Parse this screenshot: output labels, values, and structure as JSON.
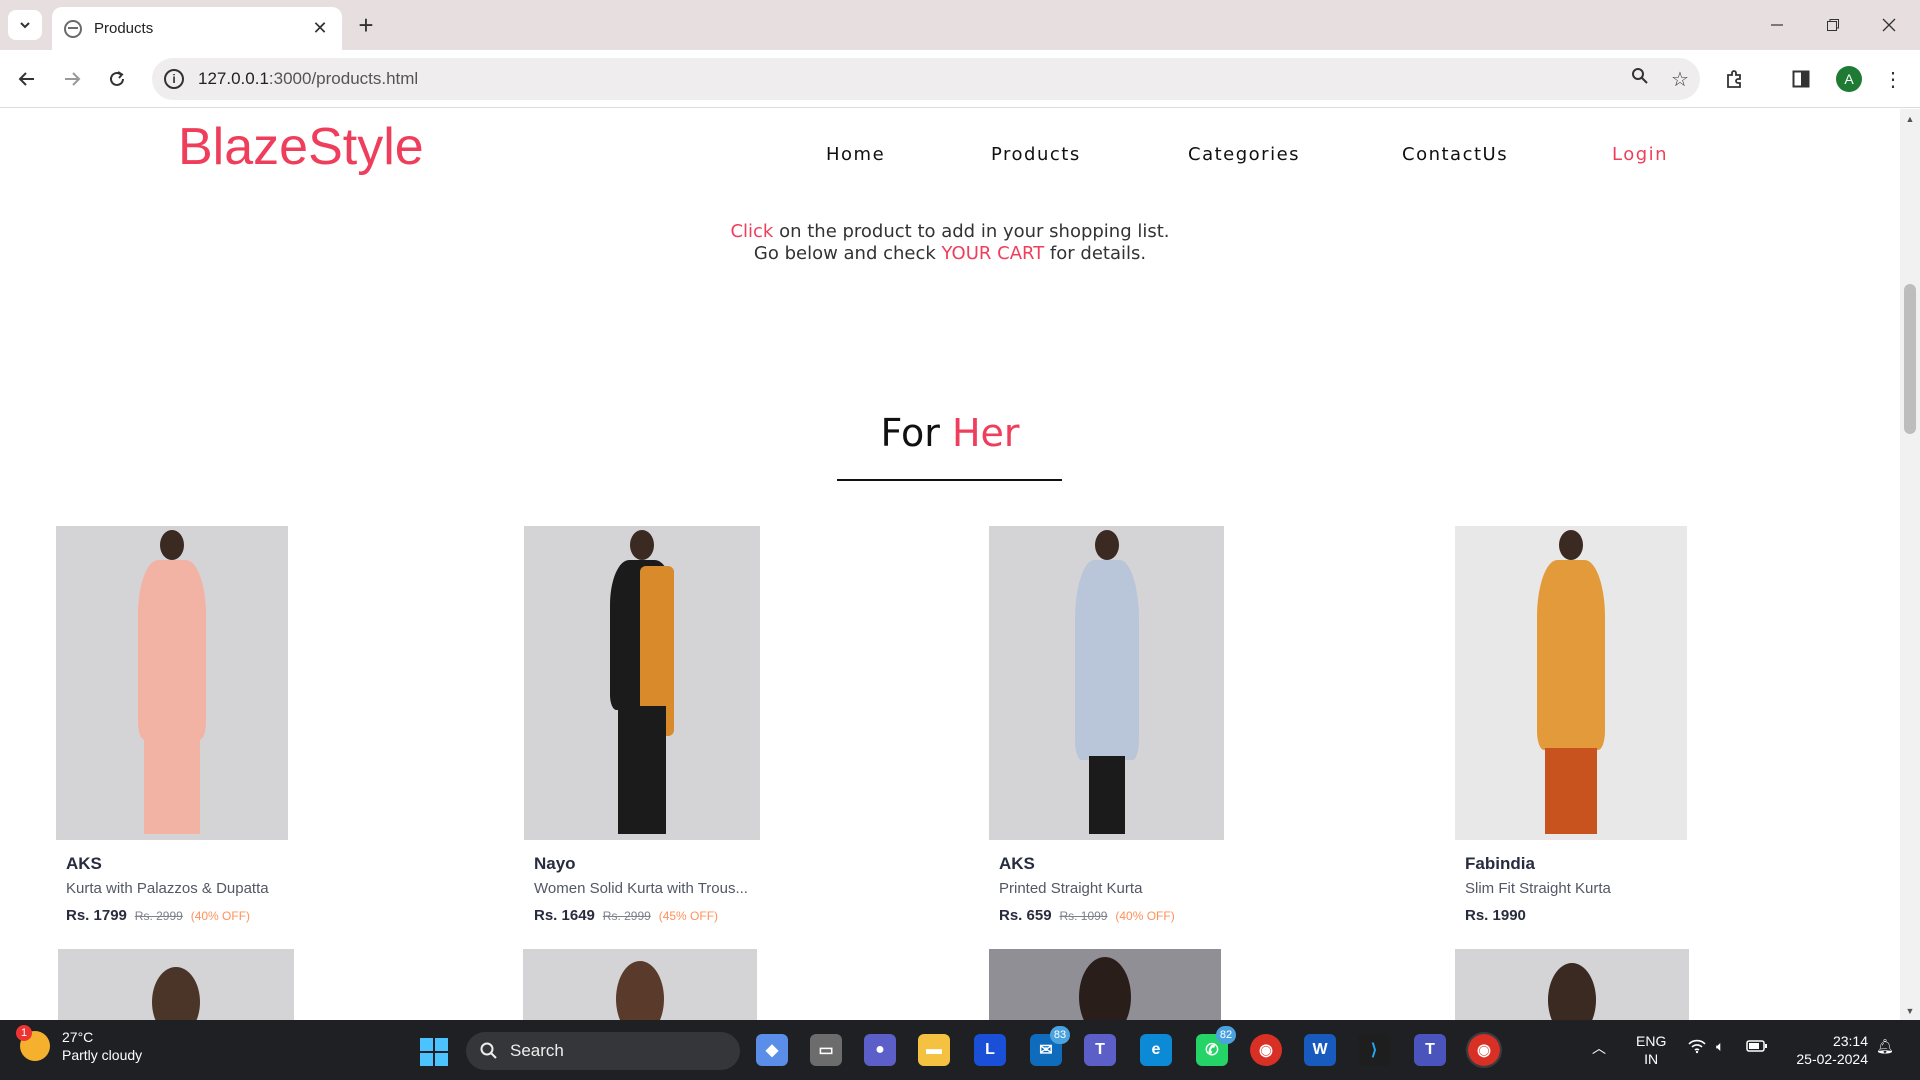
{
  "browser": {
    "tab_title": "Products",
    "url_host": "127.0.0.1",
    "url_path": ":3000/products.html",
    "profile_initial": "A"
  },
  "site": {
    "logo": "BlazeStyle",
    "nav": [
      "Home",
      "Products",
      "Categories",
      "ContactUs",
      "Login"
    ],
    "instruction_line1_accent": "Click",
    "instruction_line1_rest": " on the product to add in your shopping list.",
    "instruction_line2_start": "Go below and check ",
    "instruction_line2_accent": "YOUR CART",
    "instruction_line2_end": " for details.",
    "section_title_main": "For ",
    "section_title_accent": "Her"
  },
  "products": [
    {
      "brand": "AKS",
      "desc": "Kurta with Palazzos & Dupatta",
      "price": "Rs. 1799",
      "mrp": "Rs. 2999",
      "discount": "(40% OFF)",
      "outfit_color": "#f2b3a4"
    },
    {
      "brand": "Nayo",
      "desc": "Women Solid Kurta with Trous...",
      "price": "Rs. 1649",
      "mrp": "Rs. 2999",
      "discount": "(45% OFF)",
      "outfit_color": "#1b1b1b"
    },
    {
      "brand": "AKS",
      "desc": "Printed Straight Kurta",
      "price": "Rs. 659",
      "mrp": "Rs. 1099",
      "discount": "(40% OFF)",
      "outfit_color": "#b9c6da"
    },
    {
      "brand": "Fabindia",
      "desc": "Slim Fit Straight Kurta",
      "price": "Rs. 1990",
      "mrp": "",
      "discount": "",
      "outfit_color": "#e39a3b"
    }
  ],
  "taskbar": {
    "weather_temp": "27°C",
    "weather_desc": "Partly cloudy",
    "weather_badge": "1",
    "search_label": "Search",
    "mail_badge": "83",
    "whatsapp_badge": "82",
    "lang_line1": "ENG",
    "lang_line2": "IN",
    "time": "23:14",
    "date": "25-02-2024"
  }
}
